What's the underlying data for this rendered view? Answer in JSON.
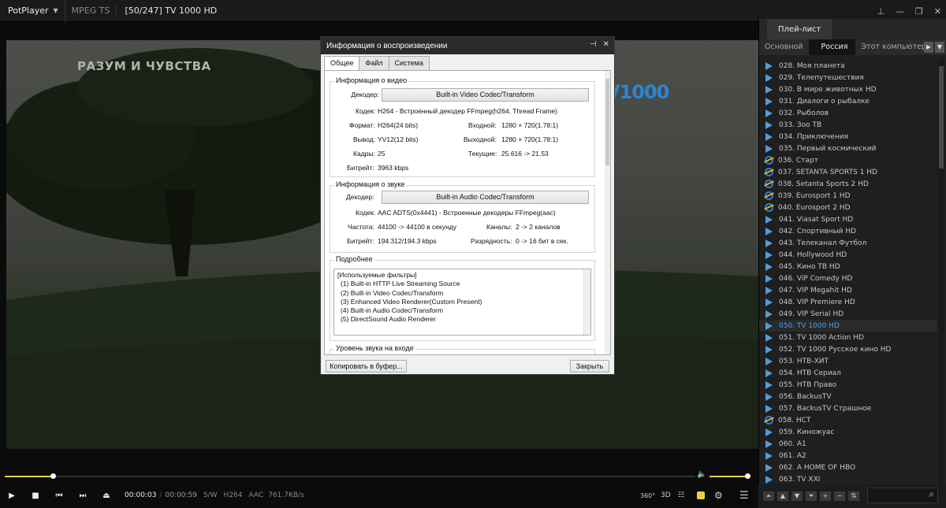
{
  "titlebar": {
    "app": "PotPlayer",
    "format": "MPEG TS",
    "title": "[50/247] TV 1000 HD"
  },
  "video": {
    "overlay_left": "РАЗУМ И ЧУВСТВА",
    "overlay_right": "V1000"
  },
  "dialog": {
    "title": "Информация о воспроизведении",
    "tabs": [
      "Общее",
      "Файл",
      "Система"
    ],
    "video_group": "Информация о видео",
    "video": {
      "decoder_label": "Декодер:",
      "decoder": "Built-in Video Codec/Transform",
      "codec_label": "Кодек:",
      "codec": "H264 - Встроенный декодер FFmpeg(h264, Thread Frame)",
      "format_label": "Формат:",
      "format": "H264(24 bits)",
      "input_label": "Входной:",
      "input": "1280 × 720(1.78:1)",
      "output_label": "Вывод:",
      "output": "YV12(12 bits)",
      "outres_label": "Выходной:",
      "outres": "1280 × 720(1.78:1)",
      "frames_label": "Кадры:",
      "frames": "25",
      "current_label": "Текущие:",
      "current": "25.616 -> 21.53",
      "bitrate_label": "Битрейт:",
      "bitrate": "3963 kbps"
    },
    "audio_group": "Информация о звуке",
    "audio": {
      "decoder_label": "Декодер:",
      "decoder": "Built-in Audio Codec/Transform",
      "codec_label": "Кодек:",
      "codec": "AAC ADTS(0x4441) - Встроенные декодеры FFmpeg(aac)",
      "freq_label": "Частота:",
      "freq": "44100 -> 44100 в секунду",
      "channels_label": "Каналы:",
      "channels": "2 -> 2 каналов",
      "bitrate_label": "Битрейт:",
      "bitrate": "194.312/194.3 kbps",
      "depth_label": "Разрядность:",
      "depth": "0 -> 16 бит в сек."
    },
    "details_group": "Подробнее",
    "filters": [
      "[Используемые фильтры]",
      " (1) Built-in HTTP Live Streaming Source",
      " (2) Built-in Video Codec/Transform",
      " (3) Enhanced Video Renderer(Custom Present)",
      " (4) Built-in Audio Codec/Transform",
      " (5) DirectSound Audio Renderer"
    ],
    "input_level_group": "Уровень звука на входе",
    "copy_button": "Копировать в буфер...",
    "close_button": "Закрыть"
  },
  "playlist": {
    "title": "Плей-лист",
    "tabs": [
      "Основной",
      "Россия",
      "Этот компьютер"
    ],
    "items": [
      {
        "label": "028. Моя планета",
        "icon": "play"
      },
      {
        "label": "029. Телепутешествия",
        "icon": "play"
      },
      {
        "label": "030. В мире животных HD",
        "icon": "play"
      },
      {
        "label": "031. Диалоги о рыбалке",
        "icon": "play"
      },
      {
        "label": "032. Рыболов",
        "icon": "play"
      },
      {
        "label": "033. Зоо ТВ",
        "icon": "play"
      },
      {
        "label": "034. Приключения",
        "icon": "play"
      },
      {
        "label": "035. Первый космический",
        "icon": "play"
      },
      {
        "label": "036. Старт",
        "icon": "ie"
      },
      {
        "label": "037. SETANTA SPORTS 1 HD",
        "icon": "ie"
      },
      {
        "label": "038. Setanta Sports 2 HD",
        "icon": "ie"
      },
      {
        "label": "039. Eurosport 1 HD",
        "icon": "ie"
      },
      {
        "label": "040. Eurosport 2 HD",
        "icon": "ie"
      },
      {
        "label": "041. Viasat Sport HD",
        "icon": "play"
      },
      {
        "label": "042. Спортивный HD",
        "icon": "play"
      },
      {
        "label": "043. Телеканал Футбол",
        "icon": "play"
      },
      {
        "label": "044. Hollywood HD",
        "icon": "play"
      },
      {
        "label": "045. Кино ТВ HD",
        "icon": "play"
      },
      {
        "label": "046. ViP Comedy HD",
        "icon": "play"
      },
      {
        "label": "047. VIP Megahit HD",
        "icon": "play"
      },
      {
        "label": "048. VIP Premiere HD",
        "icon": "play"
      },
      {
        "label": "049. VIP Serial HD",
        "icon": "play"
      },
      {
        "label": "050. TV 1000 HD",
        "icon": "play",
        "selected": true
      },
      {
        "label": "051. TV 1000 Action HD",
        "icon": "play"
      },
      {
        "label": "052. TV 1000 Русское кино HD",
        "icon": "play"
      },
      {
        "label": "053. НТВ-ХИТ",
        "icon": "play"
      },
      {
        "label": "054. НТВ Сериал",
        "icon": "play"
      },
      {
        "label": "055. НТВ Право",
        "icon": "play"
      },
      {
        "label": "056. BackusTV",
        "icon": "play"
      },
      {
        "label": "057. BackusTV Страшное",
        "icon": "play"
      },
      {
        "label": "058. НСТ",
        "icon": "ie"
      },
      {
        "label": "059. Киножуас",
        "icon": "play"
      },
      {
        "label": "060. A1",
        "icon": "play"
      },
      {
        "label": "061. A2",
        "icon": "play"
      },
      {
        "label": "062. A HOME OF HBO",
        "icon": "play"
      },
      {
        "label": "063. TV XXI",
        "icon": "play"
      }
    ]
  },
  "controls": {
    "time_current": "00:00:03",
    "time_sep": "/",
    "time_total": "00:00:59",
    "sw": "S/W",
    "vcodec": "H264",
    "acodec": "AAC",
    "rate": "761.7KB/s",
    "btn_360": "360°",
    "btn_3d": "3D",
    "progress": 0.07
  },
  "colors": {
    "accent": "#e7d23c",
    "highlight": "#4aa0e8"
  }
}
